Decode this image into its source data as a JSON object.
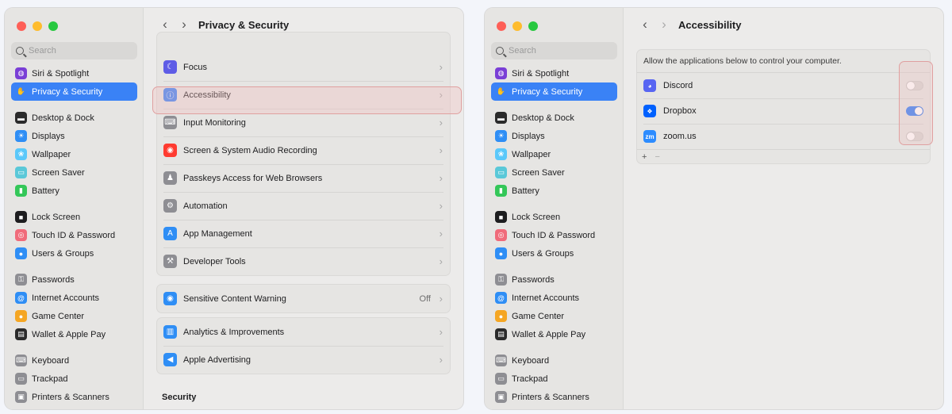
{
  "sidebar": {
    "search_placeholder": "Search",
    "items": [
      {
        "label": "Siri & Spotlight",
        "icon": "siri-icon",
        "color": "#7a3fd6"
      },
      {
        "label": "Privacy & Security",
        "icon": "hand-icon",
        "color": "#3a82f6",
        "active": true
      },
      {
        "label": "Desktop & Dock",
        "icon": "dock-icon",
        "color": "#2b2b2b"
      },
      {
        "label": "Displays",
        "icon": "display-icon",
        "color": "#2f8ef5"
      },
      {
        "label": "Wallpaper",
        "icon": "wallpaper-icon",
        "color": "#5ac8fa"
      },
      {
        "label": "Screen Saver",
        "icon": "screensaver-icon",
        "color": "#5ac8d8"
      },
      {
        "label": "Battery",
        "icon": "battery-icon",
        "color": "#34c759"
      },
      {
        "label": "Lock Screen",
        "icon": "lock-icon",
        "color": "#1d1d1f"
      },
      {
        "label": "Touch ID & Password",
        "icon": "fingerprint-icon",
        "color": "#f06b7a"
      },
      {
        "label": "Users & Groups",
        "icon": "users-icon",
        "color": "#2f8ef5"
      },
      {
        "label": "Passwords",
        "icon": "key-icon",
        "color": "#8e8e93"
      },
      {
        "label": "Internet Accounts",
        "icon": "at-icon",
        "color": "#2f8ef5"
      },
      {
        "label": "Game Center",
        "icon": "gamecenter-icon",
        "color": "#f5a623"
      },
      {
        "label": "Wallet & Apple Pay",
        "icon": "wallet-icon",
        "color": "#2b2b2b"
      },
      {
        "label": "Keyboard",
        "icon": "keyboard-icon",
        "color": "#8e8e93"
      },
      {
        "label": "Trackpad",
        "icon": "trackpad-icon",
        "color": "#8e8e93"
      },
      {
        "label": "Printers & Scanners",
        "icon": "printer-icon",
        "color": "#8e8e93"
      }
    ]
  },
  "left": {
    "title": "Privacy & Security",
    "rows": [
      {
        "label": "Focus",
        "icon": "moon-icon",
        "color": "#5e5ce6"
      },
      {
        "label": "Accessibility",
        "icon": "accessibility-icon",
        "color": "#3a82f6"
      },
      {
        "label": "Input Monitoring",
        "icon": "keyboard-icon",
        "color": "#8e8e93"
      },
      {
        "label": "Screen & System Audio Recording",
        "icon": "record-icon",
        "color": "#ff3b30"
      },
      {
        "label": "Passkeys Access for Web Browsers",
        "icon": "person-key-icon",
        "color": "#8e8e93"
      },
      {
        "label": "Automation",
        "icon": "gears-icon",
        "color": "#8e8e93"
      },
      {
        "label": "App Management",
        "icon": "appstore-icon",
        "color": "#2f8ef5"
      },
      {
        "label": "Developer Tools",
        "icon": "hammer-icon",
        "color": "#8e8e93"
      }
    ],
    "sensitive": {
      "label": "Sensitive Content Warning",
      "value": "Off",
      "icon": "eye-icon",
      "color": "#2f8ef5"
    },
    "analytics": [
      {
        "label": "Analytics & Improvements",
        "icon": "chart-icon",
        "color": "#2f8ef5"
      },
      {
        "label": "Apple Advertising",
        "icon": "megaphone-icon",
        "color": "#2f8ef5"
      }
    ],
    "security_title": "Security"
  },
  "right": {
    "title": "Accessibility",
    "description": "Allow the applications below to control your computer.",
    "apps": [
      {
        "label": "Discord",
        "icon": "discord-icon",
        "color": "#5865f2",
        "enabled": false
      },
      {
        "label": "Dropbox",
        "icon": "dropbox-icon",
        "color": "#0061fe",
        "enabled": true
      },
      {
        "label": "zoom.us",
        "icon": "zoom-icon",
        "color": "#2d8cff",
        "enabled": false
      }
    ],
    "add_label": "+",
    "remove_label": "−"
  },
  "nav": {
    "back": "‹",
    "forward": "›"
  }
}
